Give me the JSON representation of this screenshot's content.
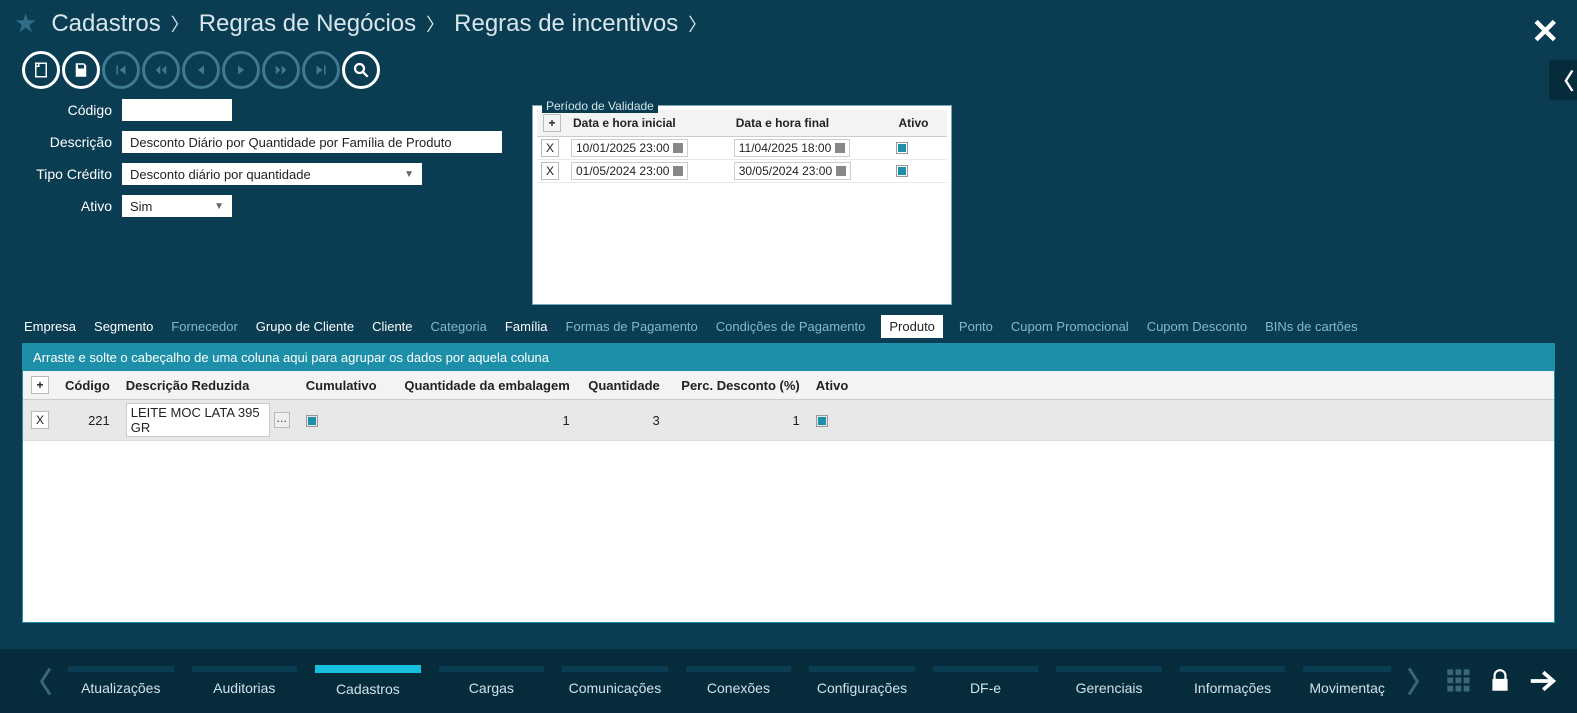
{
  "breadcrumb": {
    "c1": "Cadastros",
    "c2": "Regras de Negócios",
    "c3": "Regras de incentivos"
  },
  "form": {
    "codigo_label": "Código",
    "codigo_value": "",
    "descricao_label": "Descrição",
    "descricao_value": "Desconto Diário por Quantidade por Família de Produto",
    "tipo_label": "Tipo Crédito",
    "tipo_value": "Desconto diário por quantidade",
    "ativo_label": "Ativo",
    "ativo_value": "Sim"
  },
  "period": {
    "legend": "Período de Validade",
    "col1": "Data e hora inicial",
    "col2": "Data e hora final",
    "col3": "Ativo",
    "rows": [
      {
        "start": "10/01/2025 23:00",
        "end": "11/04/2025 18:00",
        "active": true
      },
      {
        "start": "01/05/2024 23:00",
        "end": "30/05/2024 23:00",
        "active": true
      }
    ]
  },
  "tabs": {
    "t0": "Empresa",
    "t1": "Segmento",
    "t2": "Fornecedor",
    "t3": "Grupo de Cliente",
    "t4": "Cliente",
    "t5": "Categoria",
    "t6": "Família",
    "t7": "Formas de Pagamento",
    "t8": "Condições de Pagamento",
    "t9": "Produto",
    "t10": "Ponto",
    "t11": "Cupom Promocional",
    "t12": "Cupom Desconto",
    "t13": "BINs de cartões"
  },
  "grid": {
    "groupbar": "Arraste e solte o cabeçalho de uma coluna aqui para agrupar os dados por aquela coluna",
    "h_codigo": "Código",
    "h_desc": "Descrição Reduzida",
    "h_cum": "Cumulativo",
    "h_qemb": "Quantidade da embalagem",
    "h_qtd": "Quantidade",
    "h_perc": "Perc. Desconto (%)",
    "h_ativo": "Ativo",
    "rows": [
      {
        "codigo": "221",
        "desc": "LEITE MOC LATA 395 GR",
        "cum": true,
        "qemb": "1",
        "qtd": "3",
        "perc": "1",
        "ativo": true
      }
    ]
  },
  "bottom": {
    "m0": "Atualizações",
    "m1": "Auditorias",
    "m2": "Cadastros",
    "m3": "Cargas",
    "m4": "Comunicações",
    "m5": "Conexões",
    "m6": "Configurações",
    "m7": "DF-e",
    "m8": "Gerenciais",
    "m9": "Informações",
    "m10": "Movimentaç"
  }
}
